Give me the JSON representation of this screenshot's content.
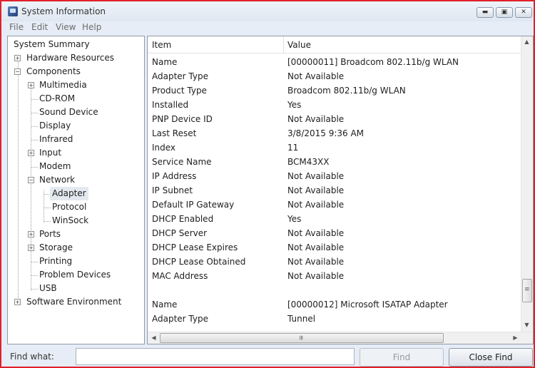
{
  "window": {
    "title": "System Information"
  },
  "caption_buttons": {
    "minimize": "▬",
    "maximize": "▣",
    "close": "✕"
  },
  "menu": [
    "File",
    "Edit",
    "View",
    "Help"
  ],
  "tree": {
    "items": [
      {
        "label": "System Summary"
      },
      {
        "label": "Hardware Resources",
        "expander": "+"
      },
      {
        "label": "Components",
        "expander": "−"
      },
      {
        "label": "Multimedia",
        "expander": "+"
      },
      {
        "label": "CD-ROM"
      },
      {
        "label": "Sound Device"
      },
      {
        "label": "Display"
      },
      {
        "label": "Infrared"
      },
      {
        "label": "Input",
        "expander": "+"
      },
      {
        "label": "Modem"
      },
      {
        "label": "Network",
        "expander": "−"
      },
      {
        "label": "Adapter",
        "selected": true
      },
      {
        "label": "Protocol"
      },
      {
        "label": "WinSock"
      },
      {
        "label": "Ports",
        "expander": "+"
      },
      {
        "label": "Storage",
        "expander": "+"
      },
      {
        "label": "Printing"
      },
      {
        "label": "Problem Devices"
      },
      {
        "label": "USB"
      },
      {
        "label": "Software Environment",
        "expander": "+"
      }
    ]
  },
  "table": {
    "columns": [
      "Item",
      "Value"
    ],
    "rows": [
      {
        "item": "Name",
        "value": "[00000011] Broadcom 802.11b/g WLAN"
      },
      {
        "item": "Adapter Type",
        "value": "Not Available"
      },
      {
        "item": "Product Type",
        "value": "Broadcom 802.11b/g WLAN"
      },
      {
        "item": "Installed",
        "value": "Yes"
      },
      {
        "item": "PNP Device ID",
        "value": "Not Available"
      },
      {
        "item": "Last Reset",
        "value": "3/8/2015 9:36 AM"
      },
      {
        "item": "Index",
        "value": "11"
      },
      {
        "item": "Service Name",
        "value": "BCM43XX"
      },
      {
        "item": "IP Address",
        "value": "Not Available"
      },
      {
        "item": "IP Subnet",
        "value": "Not Available"
      },
      {
        "item": "Default IP Gateway",
        "value": "Not Available"
      },
      {
        "item": "DHCP Enabled",
        "value": "Yes"
      },
      {
        "item": "DHCP Server",
        "value": "Not Available"
      },
      {
        "item": "DHCP Lease Expires",
        "value": "Not Available"
      },
      {
        "item": "DHCP Lease Obtained",
        "value": "Not Available"
      },
      {
        "item": "MAC Address",
        "value": "Not Available"
      },
      {
        "item": "",
        "value": ""
      },
      {
        "item": "Name",
        "value": "[00000012] Microsoft ISATAP Adapter"
      },
      {
        "item": "Adapter Type",
        "value": "Tunnel"
      }
    ]
  },
  "scrollbars": {
    "up": "▲",
    "down": "▼",
    "left": "◀",
    "right": "▶",
    "grip": "≡"
  },
  "find": {
    "label": "Find what:",
    "value": "",
    "find_button": "Find",
    "close_button": "Close Find"
  }
}
